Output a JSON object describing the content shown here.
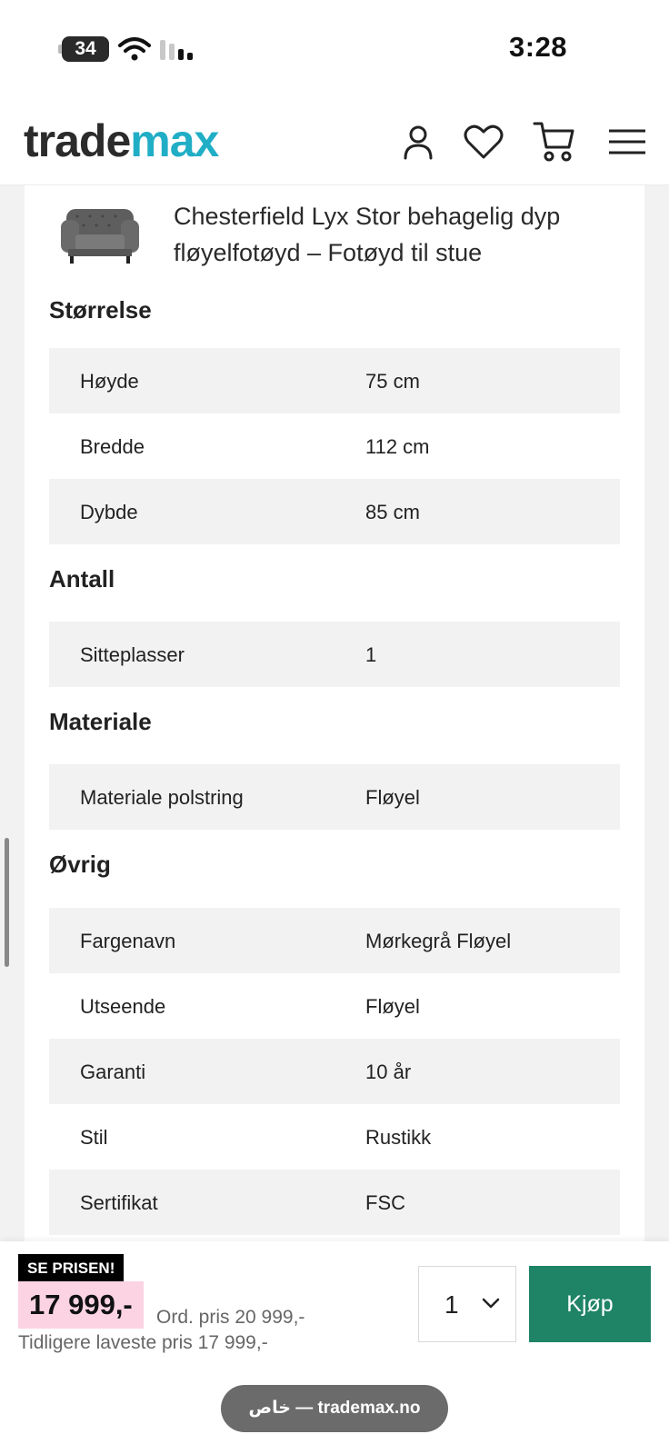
{
  "status_bar": {
    "battery": "34",
    "time": "3:28"
  },
  "header": {
    "logo_part1": "trade",
    "logo_part2": "max",
    "icons": [
      "user-icon",
      "heart-icon",
      "cart-icon",
      "menu-icon"
    ]
  },
  "product": {
    "title": "Chesterfield Lyx Stor behagelig dyp fløyelfotøyd – Fotøyd til stue"
  },
  "sections": {
    "size": {
      "title": "Størrelse",
      "rows": [
        {
          "label": "Høyde",
          "value": "75 cm"
        },
        {
          "label": "Bredde",
          "value": "112 cm"
        },
        {
          "label": "Dybde",
          "value": "85 cm"
        }
      ]
    },
    "count": {
      "title": "Antall",
      "rows": [
        {
          "label": "Sitteplasser",
          "value": "1"
        }
      ]
    },
    "material": {
      "title": "Materiale",
      "rows": [
        {
          "label": "Materiale polstring",
          "value": "Fløyel"
        }
      ]
    },
    "other": {
      "title": "Øvrig",
      "rows": [
        {
          "label": "Fargenavn",
          "value": "Mørkegrå Fløyel"
        },
        {
          "label": "Utseende",
          "value": "Fløyel"
        },
        {
          "label": "Garanti",
          "value": "10 år"
        },
        {
          "label": "Stil",
          "value": "Rustikk"
        },
        {
          "label": "Sertifikat",
          "value": "FSC"
        }
      ]
    }
  },
  "bottom_bar": {
    "badge": "SE PRISEN!",
    "price": "17 999,-",
    "ord_price": "Ord. pris 20 999,-",
    "previous_lowest": "Tidligere laveste pris 17 999,-",
    "quantity": "1",
    "buy_label": "Kjøp",
    "url_pill": "خاص — trademax.no"
  },
  "colors": {
    "accent": "#20aec6",
    "buy": "#1f8466",
    "price_bg": "#fbd3e3",
    "row_shade": "#f2f2f2"
  }
}
